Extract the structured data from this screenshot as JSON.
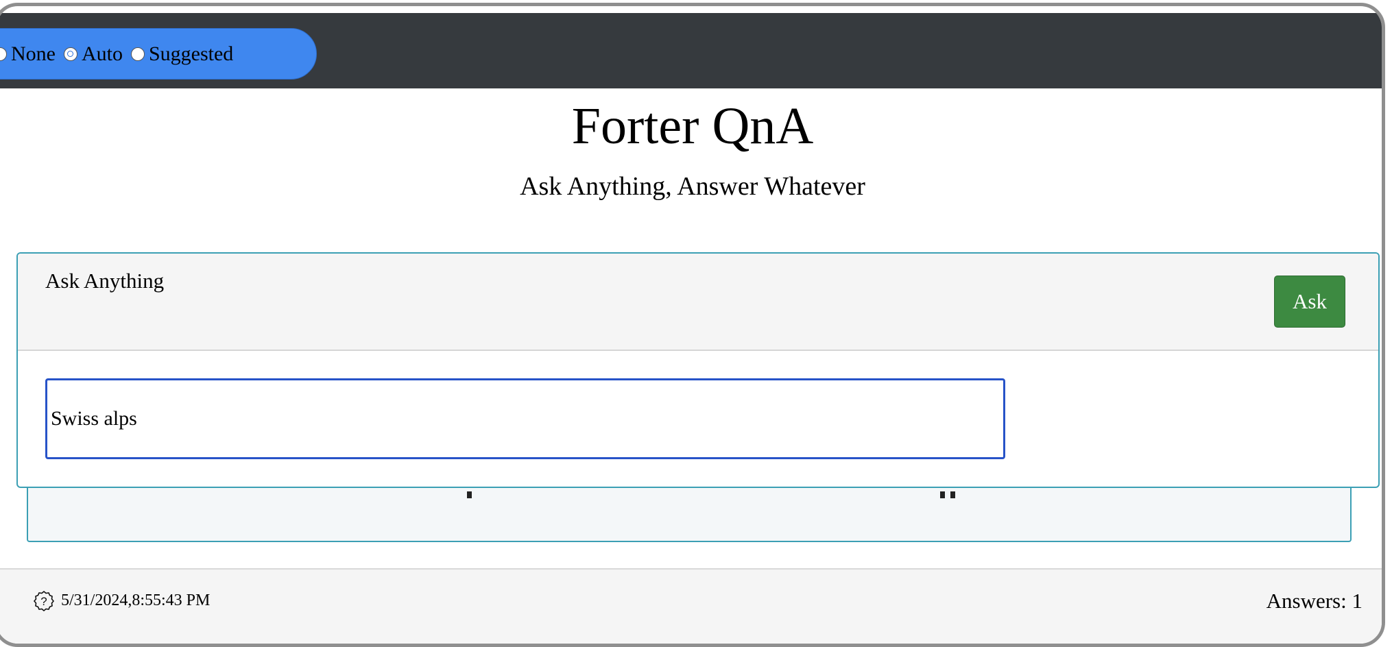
{
  "mode_selector": {
    "options": [
      {
        "label": "None",
        "checked": false
      },
      {
        "label": "Auto",
        "checked": true
      },
      {
        "label": "Suggested",
        "checked": false
      }
    ]
  },
  "header": {
    "title": "Forter QnA",
    "subtitle": "Ask Anything, Answer Whatever"
  },
  "ask_card": {
    "title": "Ask Anything",
    "button_label": "Ask",
    "input_value": "Swiss alps"
  },
  "footer": {
    "icon": "question-circle-icon",
    "timestamp": "5/31/2024,8:55:43 PM",
    "answers_count": "Answers: 1"
  },
  "colors": {
    "topbar": "#363a3e",
    "radio_pill": "#3f87ef",
    "ask_button": "#3d8a41",
    "card_border": "#3b9fb4",
    "input_border": "#2753c8"
  }
}
